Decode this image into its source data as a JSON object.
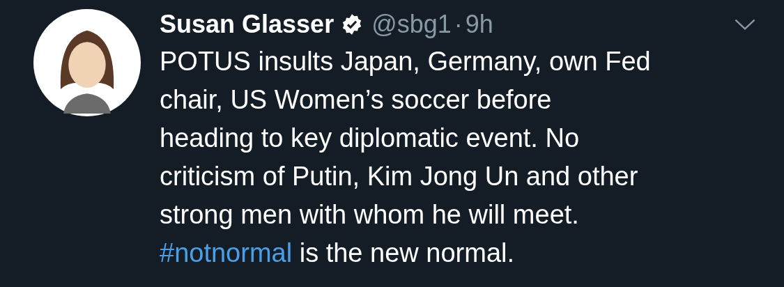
{
  "tweet": {
    "author": {
      "name": "Susan Glasser",
      "verified": true,
      "handle": "@sbg1",
      "separator": "·",
      "time": "9h"
    },
    "body": {
      "lines": [
        "POTUS insults Japan, Germany, own Fed",
        "chair, US Women’s soccer before",
        "heading to key diplomatic event. No",
        "criticism of Putin, Kim Jong Un and other",
        "strong men with whom he will meet."
      ],
      "hashtag": "#notnormal",
      "after_hashtag": "is the new normal."
    }
  }
}
